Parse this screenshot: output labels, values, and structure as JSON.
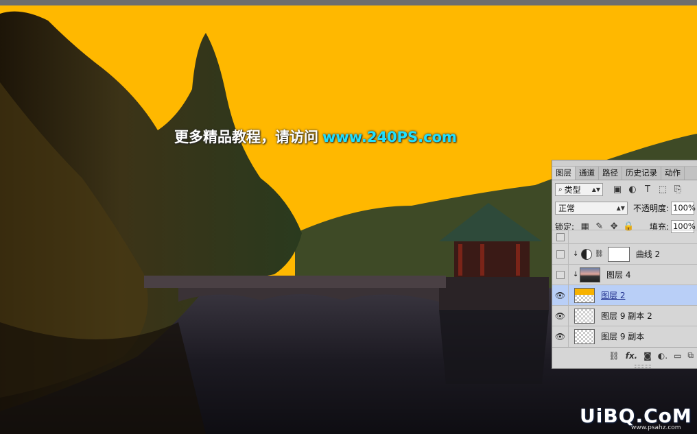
{
  "overlay": {
    "promo_text": "更多精品教程，请访问",
    "promo_url": "www.240PS.com"
  },
  "watermark": {
    "logo": "UiBQ.CoM",
    "sub": "www.psahz.com"
  },
  "layers_panel": {
    "tabs": [
      {
        "label": "图层"
      },
      {
        "label": "通道"
      },
      {
        "label": "路径"
      },
      {
        "label": "历史记录"
      },
      {
        "label": "动作"
      }
    ],
    "filter_kind": "类型",
    "blend_mode": "正常",
    "opacity_label": "不透明度:",
    "opacity_value": "100%",
    "lock_label": "锁定:",
    "fill_label": "填充:",
    "fill_value": "100%",
    "layers": [
      {
        "name": "曲线 2",
        "visible": false
      },
      {
        "name": "图层 4",
        "visible": false
      },
      {
        "name": "图层 2",
        "visible": true,
        "selected": true
      },
      {
        "name": "图层 9 副本 2",
        "visible": true
      },
      {
        "name": "图层 9 副本",
        "visible": true
      }
    ],
    "footer_icons": [
      "link-icon",
      "fx-icon",
      "mask-icon",
      "adjustment-icon",
      "folder-icon",
      "new-layer-icon",
      "trash-icon"
    ]
  },
  "colors": {
    "sky": "#ffb800",
    "url_text": "#1fe0ff",
    "selected_layer": "#b9cff7"
  }
}
